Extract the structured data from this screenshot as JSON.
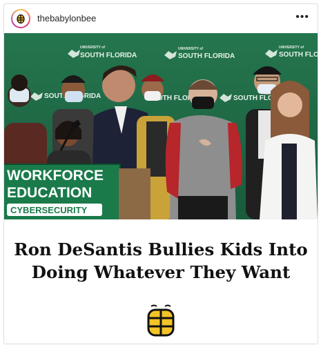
{
  "post": {
    "username": "thebabylonbee",
    "more_label": "•••"
  },
  "photo": {
    "backdrop_text": "SOUTH FLORIDA",
    "backdrop_small": "UNIVERSITY of",
    "podium_lines": [
      "WORKFORCE",
      "EDUCATION"
    ],
    "podium_tag": "CYBERSECURITY"
  },
  "headline": {
    "line1": "Ron DeSantis Bullies Kids Into",
    "line2": "Doing Whatever They Want"
  },
  "colors": {
    "backdrop_green": "#1f6b47",
    "podium_green": "#1a7a4a",
    "brand_yellow": "#f2c428"
  }
}
